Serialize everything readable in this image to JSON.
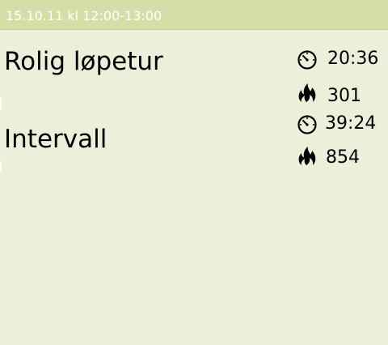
{
  "header": {
    "datetime": "15.10.11 kl 12:00-13:00"
  },
  "activities": [
    {
      "name": "Rolig løpetur",
      "duration": "20:36",
      "duration_icon": "stopwatch-icon",
      "calories": "301",
      "calories_icon": "flame-icon"
    },
    {
      "name": "Intervall",
      "duration": "39:24",
      "duration_icon": "stopwatch-icon",
      "calories": "854",
      "calories_icon": "flame-icon"
    }
  ]
}
